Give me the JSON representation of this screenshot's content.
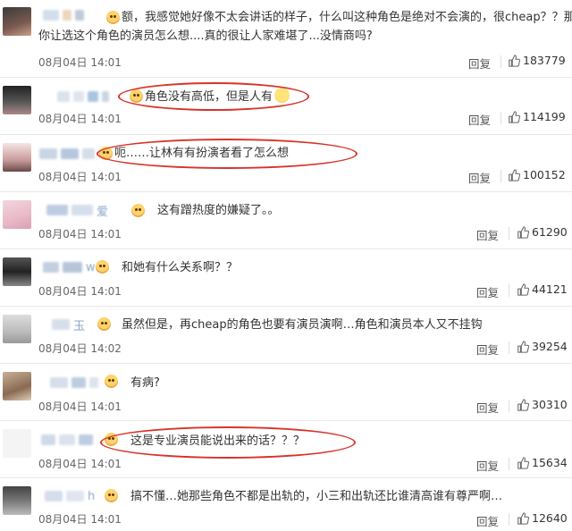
{
  "comments": [
    {
      "nick_fragment": "",
      "text_line1": "额，我感觉她好像不太会讲话的样子，什么叫这种角色是绝对不会演的，很cheap？？那",
      "text_line2": "你让选这个角色的演员怎么想....真的很让人家难堪了...没情商吗?",
      "time": "08月04日 14:01",
      "reply": "回复",
      "likes": "183779"
    },
    {
      "nick_fragment": "",
      "text": "角色没有高低，但是人有",
      "time": "08月04日 14:01",
      "reply": "回复",
      "likes": "114199"
    },
    {
      "nick_fragment": "",
      "text": "呃……让林有有扮演者看了怎么想",
      "time": "08月04日 14:01",
      "reply": "回复",
      "likes": "100152"
    },
    {
      "nick_fragment": "爱",
      "text": "这有蹭热度的嫌疑了。。",
      "time": "08月04日 14:01",
      "reply": "回复",
      "likes": "61290"
    },
    {
      "nick_fragment": "w",
      "text": "和她有什么关系啊？？",
      "time": "08月04日 14:01",
      "reply": "回复",
      "likes": "44121"
    },
    {
      "nick_fragment": "玉",
      "text": "虽然但是，再cheap的角色也要有演员演啊…角色和演员本人又不挂钩",
      "time": "08月04日 14:02",
      "reply": "回复",
      "likes": "39254"
    },
    {
      "nick_fragment": "",
      "text": "有病?",
      "time": "08月04日 14:01",
      "reply": "回复",
      "likes": "30310"
    },
    {
      "nick_fragment": "",
      "text": "这是专业演员能说出来的话？？？",
      "time": "08月04日 14:01",
      "reply": "回复",
      "likes": "15634"
    },
    {
      "nick_fragment": "h",
      "text": "搞不懂…她那些角色不都是出轨的，小三和出轨还比谁清高谁有尊严啊…",
      "time": "08月04日 14:01",
      "reply": "回复",
      "likes": "12640"
    }
  ],
  "colors": {
    "highlight_oval": "#d7342a",
    "separator": "#e8e8e8"
  }
}
